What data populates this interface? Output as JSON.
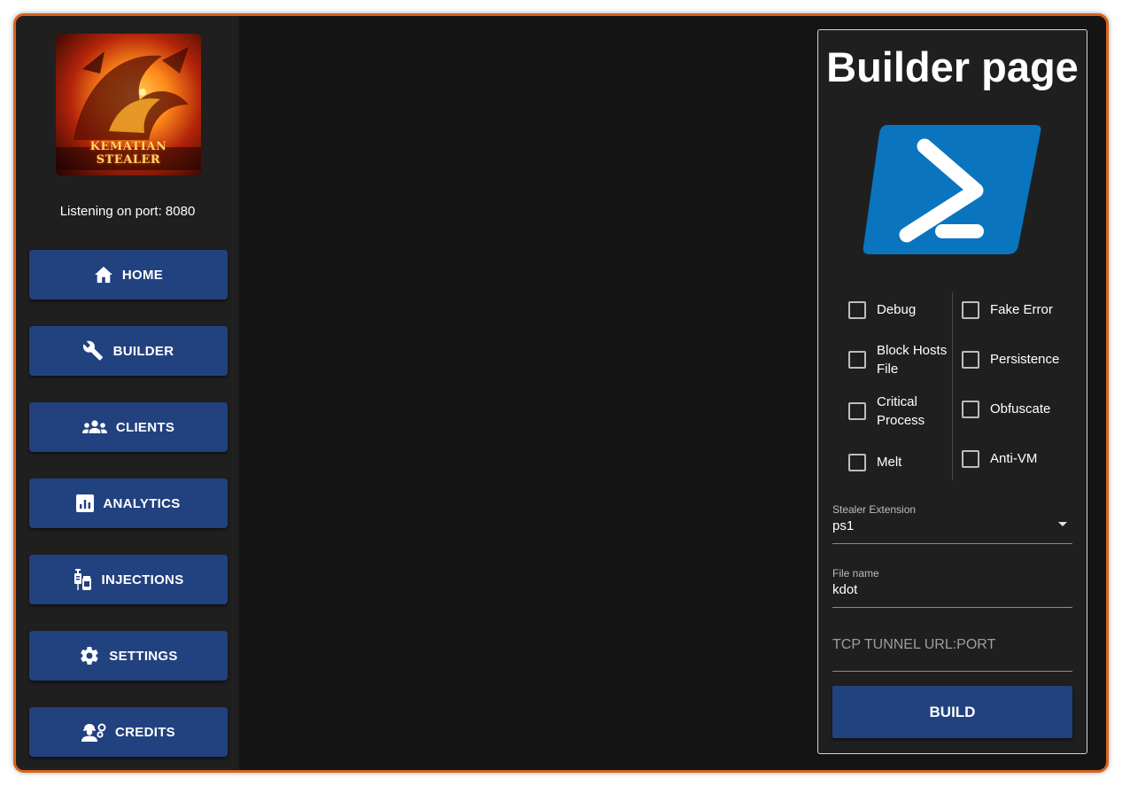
{
  "sidebar": {
    "logo_text": "KEMATIAN STEALER",
    "status": "Listening on port: 8080",
    "items": [
      {
        "label": "HOME",
        "icon": "home-icon"
      },
      {
        "label": "BUILDER",
        "icon": "wrench-icon"
      },
      {
        "label": "CLIENTS",
        "icon": "group-icon"
      },
      {
        "label": "ANALYTICS",
        "icon": "analytics-icon"
      },
      {
        "label": "INJECTIONS",
        "icon": "syringe-vial-icon"
      },
      {
        "label": "SETTINGS",
        "icon": "gear-icon"
      },
      {
        "label": "CREDITS",
        "icon": "engineer-icon"
      }
    ]
  },
  "builder": {
    "title": "Builder page",
    "logo_icon": "powershell-icon",
    "options_left": [
      {
        "label": "Debug",
        "checked": false
      },
      {
        "label": "Block Hosts File",
        "checked": false
      },
      {
        "label": "Critical Process",
        "checked": false
      },
      {
        "label": "Melt",
        "checked": false
      }
    ],
    "options_right": [
      {
        "label": "Fake Error",
        "checked": false
      },
      {
        "label": "Persistence",
        "checked": false
      },
      {
        "label": "Obfuscate",
        "checked": false
      },
      {
        "label": "Anti-VM",
        "checked": false
      }
    ],
    "extension": {
      "label": "Stealer Extension",
      "value": "ps1"
    },
    "file_name": {
      "label": "File name",
      "value": "kdot"
    },
    "tunnel": {
      "placeholder": "TCP TUNNEL URL:PORT"
    },
    "build_label": "BUILD"
  },
  "colors": {
    "accent_button": "#22417f",
    "window_border": "#d9621f",
    "powershell_blue": "#0a74bf"
  }
}
